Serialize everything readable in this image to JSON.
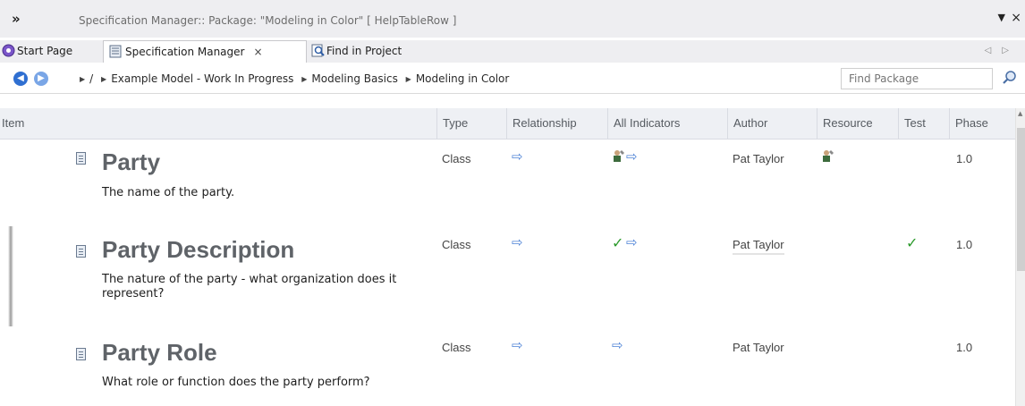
{
  "window": {
    "title": "Specification Manager::  Package: \"Modeling in Color\"  [ HelpTableRow ]"
  },
  "tabs": [
    {
      "label": "Start Page"
    },
    {
      "label": "Specification Manager"
    },
    {
      "label": "Find in Project"
    }
  ],
  "breadcrumb": {
    "root": "/",
    "items": [
      "Example Model - Work In Progress",
      "Modeling Basics",
      "Modeling in Color"
    ]
  },
  "search": {
    "placeholder": "Find Package"
  },
  "table": {
    "columns": [
      "Item",
      "Type",
      "Relationship",
      "All Indicators",
      "Author",
      "Resource",
      "Test",
      "Phase"
    ],
    "rows": [
      {
        "title": "Party",
        "notes": "The name of the party.",
        "type": "Class",
        "relationship": "arrow-icon",
        "indicators": [
          "resource-icon",
          "arrow-icon"
        ],
        "author": "Pat Taylor",
        "resource": "resource-icon",
        "test": "",
        "phase": "1.0"
      },
      {
        "title": "Party Description",
        "notes": "The nature of the party - what organization does it represent?",
        "type": "Class",
        "relationship": "arrow-icon",
        "indicators": [
          "check-icon",
          "arrow-icon"
        ],
        "author": "Pat Taylor",
        "resource": "",
        "test": "check-icon",
        "phase": "1.0"
      },
      {
        "title": "Party Role",
        "notes": "What role or function does the party perform?",
        "type": "Class",
        "relationship": "arrow-icon",
        "indicators": [
          "arrow-icon"
        ],
        "author": "Pat Taylor",
        "resource": "",
        "test": "",
        "phase": "1.0"
      }
    ]
  },
  "colors": {
    "accent_blue": "#4d82d6",
    "check_green": "#2b9a2b",
    "title_gray": "#5f6368"
  }
}
